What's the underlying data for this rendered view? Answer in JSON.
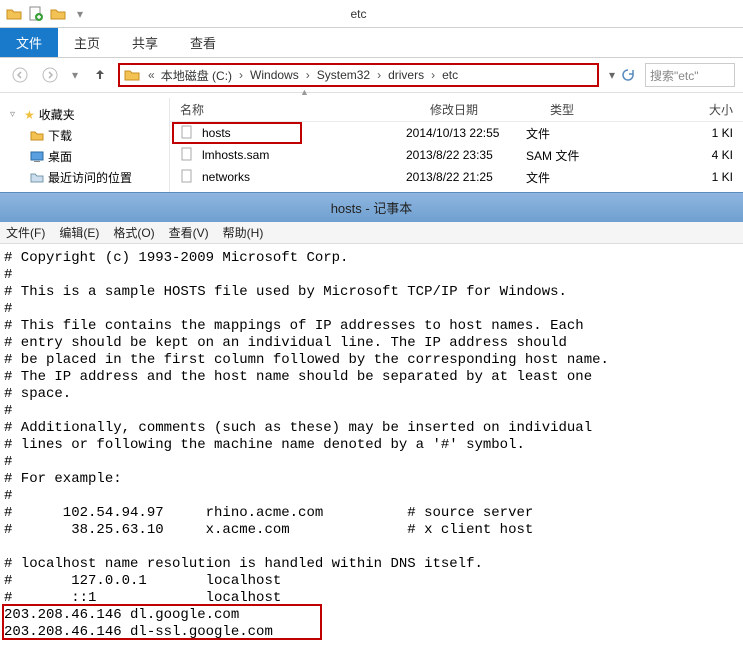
{
  "explorer": {
    "title": "etc",
    "tabs": {
      "file": "文件",
      "home": "主页",
      "share": "共享",
      "view": "查看"
    },
    "breadcrumb": {
      "prefix": "«",
      "items": [
        "本地磁盘 (C:)",
        "Windows",
        "System32",
        "drivers",
        "etc"
      ]
    },
    "search_placeholder": "搜索\"etc\"",
    "nav": {
      "favorites": "收藏夹",
      "downloads": "下载",
      "desktop": "桌面",
      "recent": "最近访问的位置"
    },
    "columns": {
      "name": "名称",
      "date": "修改日期",
      "type": "类型",
      "size": "大小"
    },
    "files": [
      {
        "name": "hosts",
        "date": "2014/10/13 22:55",
        "type": "文件",
        "size": "1 KI"
      },
      {
        "name": "lmhosts.sam",
        "date": "2013/8/22 23:35",
        "type": "SAM 文件",
        "size": "4 KI"
      },
      {
        "name": "networks",
        "date": "2013/8/22 21:25",
        "type": "文件",
        "size": "1 KI"
      }
    ]
  },
  "notepad": {
    "title": "hosts - 记事本",
    "menu": {
      "file": "文件(F)",
      "edit": "编辑(E)",
      "format": "格式(O)",
      "view": "查看(V)",
      "help": "帮助(H)"
    },
    "content": "# Copyright (c) 1993-2009 Microsoft Corp.\n#\n# This is a sample HOSTS file used by Microsoft TCP/IP for Windows.\n#\n# This file contains the mappings of IP addresses to host names. Each\n# entry should be kept on an individual line. The IP address should\n# be placed in the first column followed by the corresponding host name.\n# The IP address and the host name should be separated by at least one\n# space.\n#\n# Additionally, comments (such as these) may be inserted on individual\n# lines or following the machine name denoted by a '#' symbol.\n#\n# For example:\n#\n#      102.54.94.97     rhino.acme.com          # source server\n#       38.25.63.10     x.acme.com              # x client host\n\n# localhost name resolution is handled within DNS itself.\n#\t127.0.0.1       localhost\n#\t::1             localhost\n203.208.46.146 dl.google.com\n203.208.46.146 dl-ssl.google.com"
  }
}
